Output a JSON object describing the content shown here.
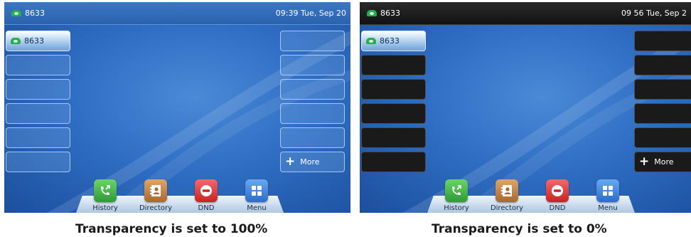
{
  "screens": [
    {
      "account": "8633",
      "time": "09:39 Tue, Sep 20",
      "left_keys": [
        "8633",
        "",
        "",
        "",
        "",
        ""
      ],
      "right_keys": [
        "",
        "",
        "",
        "",
        "",
        "More"
      ],
      "softkeys": [
        "History",
        "Directory",
        "DND",
        "Menu"
      ],
      "caption": "Transparency is set to 100%"
    },
    {
      "account": "8633",
      "time": "09 56 Tue, Sep 2",
      "left_keys": [
        "8633",
        "",
        "",
        "",
        "",
        ""
      ],
      "right_keys": [
        "",
        "",
        "",
        "",
        "",
        "More"
      ],
      "softkeys": [
        "History",
        "Directory",
        "DND",
        "Menu"
      ],
      "caption": "Transparency is set to 0%"
    }
  ],
  "icons": {
    "account": "phone-icon",
    "more": "plus-icon",
    "history": "history-icon",
    "directory": "directory-icon",
    "dnd": "dnd-icon",
    "menu": "menu-grid-icon"
  },
  "colors": {
    "wallpaper_blue": "#2f6ec4",
    "status_green": "#22b04a",
    "linekey_transparent": "#8cb9eb",
    "linekey_opaque": "#1a1a1a"
  }
}
